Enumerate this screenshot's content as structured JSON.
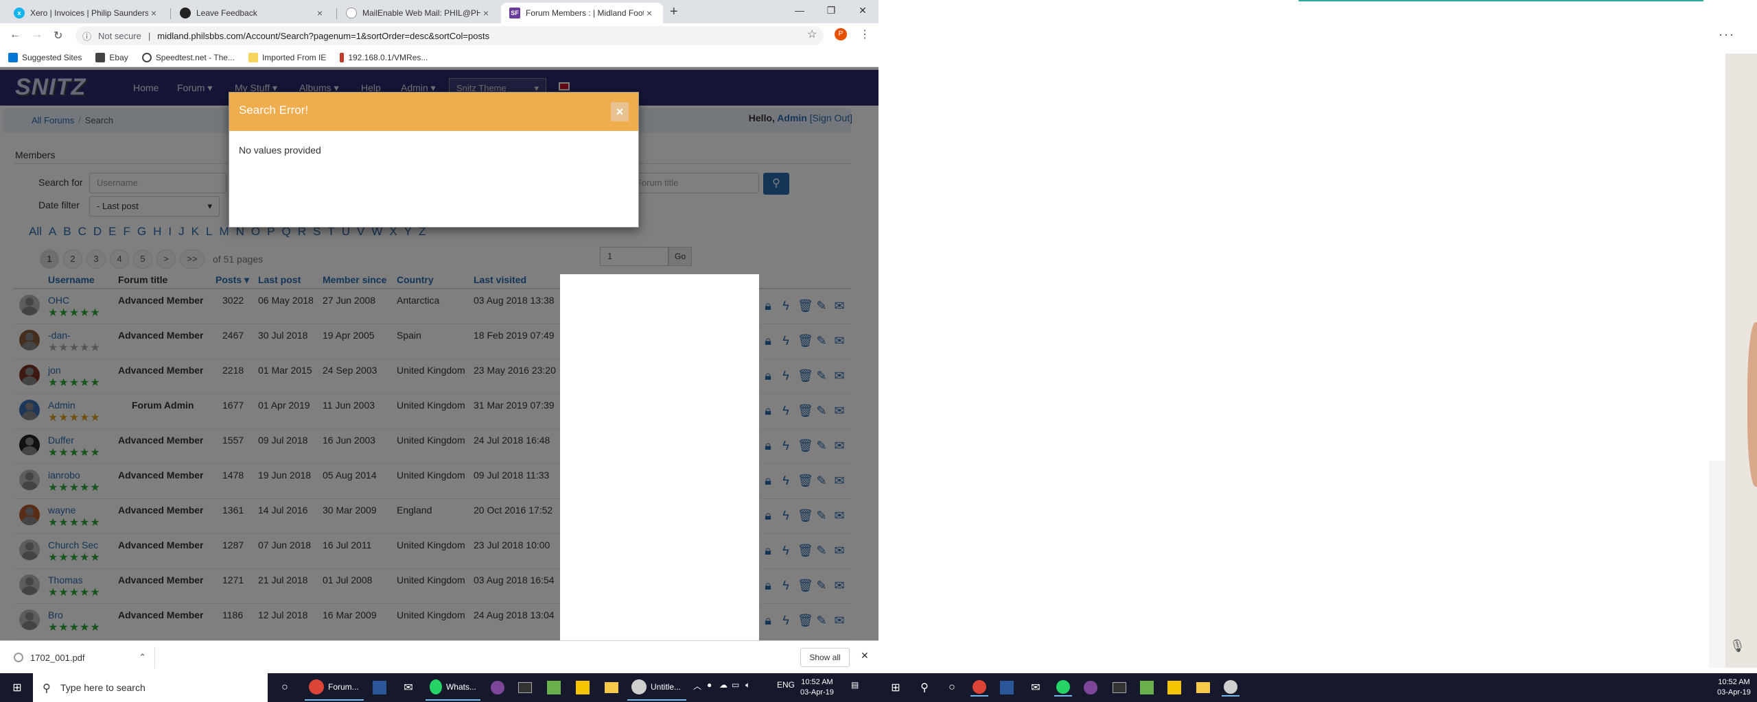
{
  "browser": {
    "tabs": [
      {
        "title": "Xero | Invoices | Philip Saunders",
        "color": "#13b5ea"
      },
      {
        "title": "Leave Feedback",
        "color": "#222"
      },
      {
        "title": "MailEnable Web Mail: PHIL@PHI",
        "color": "#999"
      },
      {
        "title": "Forum Members : | Midland Foot",
        "color": "#6a3d9a"
      }
    ],
    "url_prefix": "Not secure",
    "url": "midland.philsbbs.com/Account/Search?pagenum=1&sortOrder=desc&sortCol=posts",
    "profile_initial": "P",
    "bookmarks": [
      "Suggested Sites",
      "Ebay",
      "Speedtest.net - The...",
      "Imported From IE",
      "192.168.0.1/VMRes..."
    ]
  },
  "site": {
    "logo": "SNITZ",
    "nav": [
      "Home",
      "Forum ▾",
      "My Stuff ▾",
      "Albums ▾",
      "Help",
      "Admin ▾"
    ],
    "theme_select": "Snitz Theme",
    "breadcrumb": [
      "All Forums",
      "Search"
    ],
    "hello": "Hello,",
    "user": "Admin",
    "signout": "[Sign Out]"
  },
  "search": {
    "section_title": "Members",
    "search_for_label": "Search for",
    "username_placeholder": "Username",
    "forum_title_placeholder": "Forum title",
    "date_filter_label": "Date filter",
    "date_filter_value": "- Last post"
  },
  "alphabet": [
    "All",
    "A",
    "B",
    "C",
    "D",
    "E",
    "F",
    "G",
    "H",
    "I",
    "J",
    "K",
    "L",
    "M",
    "N",
    "O",
    "P",
    "Q",
    "R",
    "S",
    "T",
    "U",
    "V",
    "W",
    "X",
    "Y",
    "Z"
  ],
  "pager": {
    "pages": [
      "1",
      "2",
      "3",
      "4",
      "5",
      ">",
      ">>"
    ],
    "of_text": "of 51 pages",
    "goto_value": "1",
    "go_label": "Go"
  },
  "table": {
    "headers": [
      "Username",
      "Forum title",
      "Posts ▾",
      "Last post",
      "Member since",
      "Country",
      "Last visited"
    ],
    "rows": [
      {
        "username": "OHC",
        "title": "Advanced Member",
        "posts": "3022",
        "last_post": "06 May 2018",
        "since": "27 Jun 2008",
        "country": "Antarctica",
        "visited": "03 Aug 2018 13:38",
        "star_color": "#2eaa3b",
        "avatar": "#bbb"
      },
      {
        "username": "-dan-",
        "title": "Advanced Member",
        "posts": "2467",
        "last_post": "30 Jul 2018",
        "since": "19 Apr 2005",
        "country": "Spain",
        "visited": "18 Feb 2019 07:49",
        "star_color": "#aaaaaa",
        "avatar": "#8a5a3a"
      },
      {
        "username": "jon",
        "title": "Advanced Member",
        "posts": "2218",
        "last_post": "01 Mar 2015",
        "since": "24 Sep 2003",
        "country": "United Kingdom",
        "visited": "23 May 2016 23:20",
        "star_color": "#2eaa3b",
        "avatar": "#7a3322"
      },
      {
        "username": "Admin",
        "title": "Forum Admin",
        "posts": "1677",
        "last_post": "01 Apr 2019",
        "since": "11 Jun 2003",
        "country": "United Kingdom",
        "visited": "31 Mar 2019 07:39",
        "star_color": "#e0a020",
        "avatar": "#3b6fb5"
      },
      {
        "username": "Duffer",
        "title": "Advanced Member",
        "posts": "1557",
        "last_post": "09 Jul 2018",
        "since": "16 Jun 2003",
        "country": "United Kingdom",
        "visited": "24 Jul 2018 16:48",
        "star_color": "#2eaa3b",
        "avatar": "#222"
      },
      {
        "username": "ianrobo",
        "title": "Advanced Member",
        "posts": "1478",
        "last_post": "19 Jun 2018",
        "since": "05 Aug 2014",
        "country": "United Kingdom",
        "visited": "09 Jul 2018 11:33",
        "star_color": "#2eaa3b",
        "avatar": "#bbb"
      },
      {
        "username": "wayne",
        "title": "Advanced Member",
        "posts": "1361",
        "last_post": "14 Jul 2016",
        "since": "30 Mar 2009",
        "country": "England",
        "visited": "20 Oct 2016 17:52",
        "star_color": "#2eaa3b",
        "avatar": "#b35a2a"
      },
      {
        "username": "Church Sec",
        "title": "Advanced Member",
        "posts": "1287",
        "last_post": "07 Jun 2018",
        "since": "16 Jul 2011",
        "country": "United Kingdom",
        "visited": "23 Jul 2018 10:00",
        "star_color": "#2eaa3b",
        "avatar": "#bbb"
      },
      {
        "username": "Thomas",
        "title": "Advanced Member",
        "posts": "1271",
        "last_post": "21 Jul 2018",
        "since": "01 Jul 2008",
        "country": "United Kingdom",
        "visited": "03 Aug 2018 16:54",
        "star_color": "#2eaa3b",
        "avatar": "#bbb"
      },
      {
        "username": "Bro",
        "title": "Advanced Member",
        "posts": "1186",
        "last_post": "12 Jul 2018",
        "since": "16 Mar 2009",
        "country": "United Kingdom",
        "visited": "24 Aug 2018 13:04",
        "star_color": "#2eaa3b",
        "avatar": "#bbb"
      }
    ]
  },
  "modal": {
    "title": "Search Error!",
    "message": "No values provided",
    "close": "×"
  },
  "downloads": {
    "file": "1702_001.pdf",
    "show_all": "Show all"
  },
  "taskbar": {
    "search_placeholder": "Type here to search",
    "apps": [
      "Forum...",
      "Whats...",
      "Untitle..."
    ],
    "lang": "ENG",
    "time": "10:52 AM",
    "date": "03-Apr-19"
  }
}
